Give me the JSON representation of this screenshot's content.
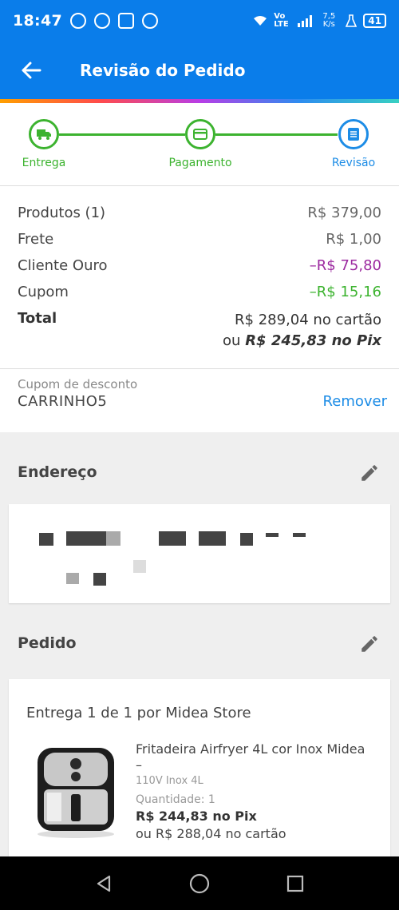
{
  "status_bar": {
    "time": "18:47",
    "network": "Vo LTE",
    "speed": "7,5 K/s",
    "battery": "41"
  },
  "app_bar": {
    "title": "Revisão do Pedido",
    "back_icon": "arrow-left-icon"
  },
  "stepper": {
    "steps": [
      {
        "label": "Entrega",
        "icon": "truck-icon",
        "state": "done"
      },
      {
        "label": "Pagamento",
        "icon": "card-icon",
        "state": "done"
      },
      {
        "label": "Revisão",
        "icon": "document-icon",
        "state": "active"
      }
    ]
  },
  "summary": {
    "products_label": "Produtos (1)",
    "products_value": "R$ 379,00",
    "shipping_label": "Frete",
    "shipping_value": "R$ 1,00",
    "gold_label": "Cliente Ouro",
    "gold_value": "–R$ 75,80",
    "coupon_label": "Cupom",
    "coupon_value": "–R$ 15,16",
    "total_label": "Total",
    "total_card": "R$ 289,04 no cartão",
    "total_pix_prefix": "ou",
    "total_pix": "R$ 245,83 no Pix"
  },
  "coupon": {
    "label": "Cupom de desconto",
    "code": "CARRINHO5",
    "remove_label": "Remover"
  },
  "address": {
    "title": "Endereço"
  },
  "order": {
    "title": "Pedido",
    "seller_line": "Entrega 1 de 1 por Midea Store",
    "product_name": "Fritadeira Airfryer 4L cor Inox Midea –",
    "variant": "110V Inox 4L",
    "quantity_label": "Quantidade:",
    "quantity": "1",
    "price_pix": "R$ 244,83 no Pix",
    "price_card": "ou R$ 288,04 no cartão"
  },
  "colors": {
    "primary": "#0a7dea",
    "success": "#3cb32f",
    "link": "#1c8ce6",
    "discount_purple": "#9c2aa0"
  }
}
